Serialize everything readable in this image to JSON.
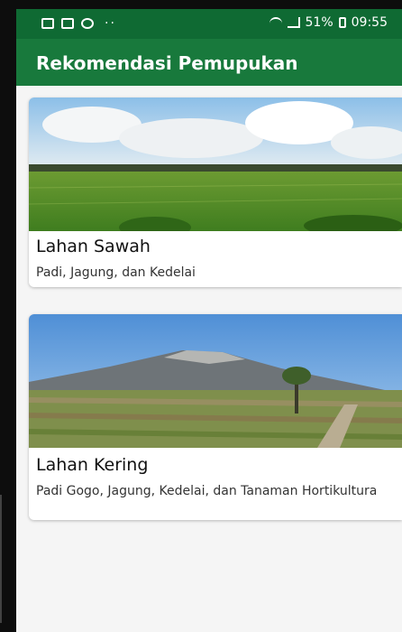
{
  "status_bar": {
    "battery": "51%",
    "time": "09:55"
  },
  "appbar": {
    "title": "Rekomendasi Pemupukan"
  },
  "cards": [
    {
      "title": "Lahan Sawah",
      "subtitle": "Padi, Jagung, dan Kedelai"
    },
    {
      "title": "Lahan Kering",
      "subtitle": "Padi Gogo, Jagung, Kedelai, dan Tanaman Hortikultura"
    }
  ],
  "colors": {
    "status_bar": "#0f6a33",
    "appbar": "#18793c",
    "background": "#f5f5f5"
  }
}
